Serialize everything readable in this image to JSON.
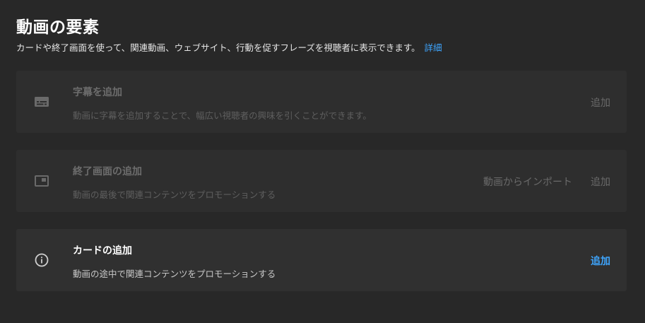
{
  "header": {
    "title": "動画の要素",
    "description": "カードや終了画面を使って、関連動画、ウェブサイト、行動を促すフレーズを視聴者に表示できます。",
    "details_link": "詳細"
  },
  "elements": [
    {
      "icon": "subtitles-icon",
      "title": "字幕を追加",
      "description": "動画に字幕を追加することで、幅広い視聴者の興味を引くことができます。",
      "add_label": "追加",
      "enabled": false
    },
    {
      "icon": "end-screen-icon",
      "title": "終了画面の追加",
      "description": "動画の最後で関連コンテンツをプロモーションする",
      "import_label": "動画からインポート",
      "add_label": "追加",
      "enabled": false
    },
    {
      "icon": "info-icon",
      "title": "カードの追加",
      "description": "動画の途中で関連コンテンツをプロモーションする",
      "add_label": "追加",
      "enabled": true
    }
  ],
  "colors": {
    "background": "#282828",
    "card": "#2e2e2e",
    "accent": "#3ea6ff",
    "disabled_text": "#6d6d6d"
  }
}
